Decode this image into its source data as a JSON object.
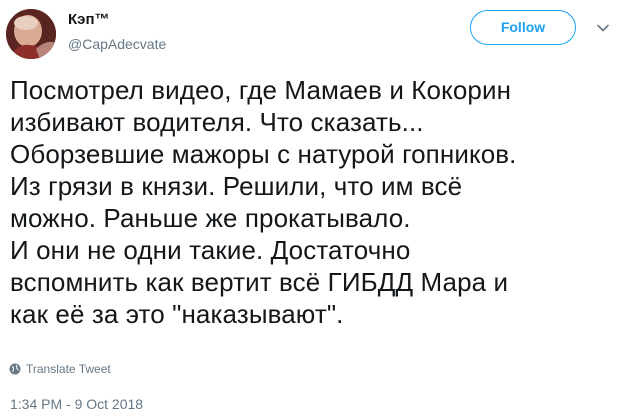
{
  "tweet": {
    "author": {
      "display_name": "Кэп™",
      "screen_name": "@CapAdecvate",
      "avatar_icon": "avatar-photo"
    },
    "follow_label": "Follow",
    "caret_icon": "chevron-down-icon",
    "text": "Посмотрел видео, где Мамаев и Кокорин\nизбивают водителя. Что сказать...\nОборзевшие мажоры с натурой гопников.\nИз грязи в князи. Решили, что им всё\nможно. Раньше же прокатывало.\nИ они не одни такие. Достаточно\nвспомнить как вертит всё ГИБДД Мара и\nкак её за это \"наказывают\".",
    "translate_label": "Translate Tweet",
    "translate_icon": "globe-icon",
    "timestamp": "1:34 PM - 9 Oct 2018"
  },
  "colors": {
    "accent": "#1da1f2",
    "text": "#14171a",
    "secondary": "#657786"
  }
}
